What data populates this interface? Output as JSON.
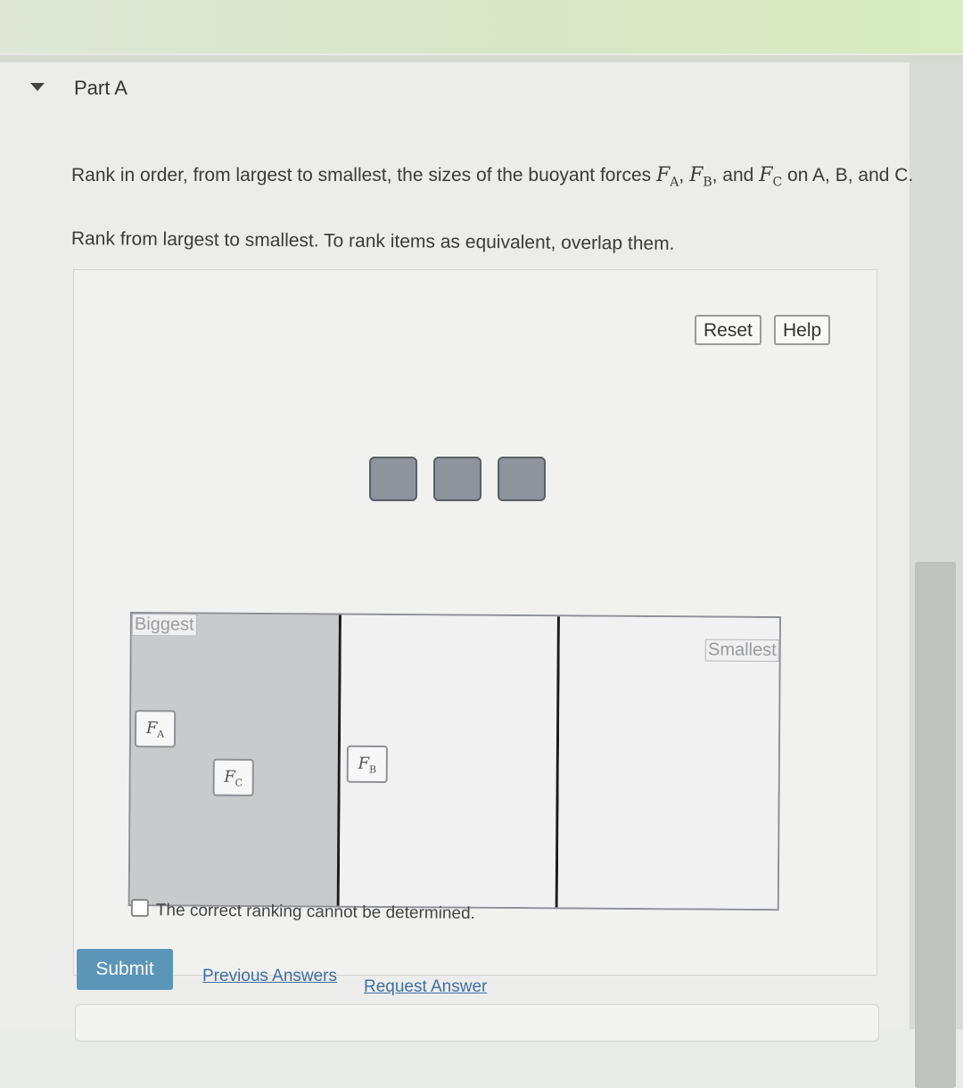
{
  "part": {
    "title": "Part A"
  },
  "question": {
    "text_before": "Rank in order, from largest to smallest, the sizes of the buoyant forces",
    "fa_letter": "F",
    "fa_sub": "A",
    "sep1": ",",
    "fb_letter": "F",
    "fb_sub": "B",
    "sep2": ", and",
    "fc_letter": "F",
    "fc_sub": "C",
    "text_after": "on A, B, and C."
  },
  "instruction": "Rank from largest to smallest. To rank items as equivalent, overlap them.",
  "toolbar": {
    "reset_label": "Reset",
    "help_label": "Help"
  },
  "ranking": {
    "biggest_label": "Biggest",
    "smallest_label": "Smallest",
    "items": [
      {
        "letter": "F",
        "sub": "A"
      },
      {
        "letter": "F",
        "sub": "C"
      },
      {
        "letter": "F",
        "sub": "B"
      }
    ]
  },
  "cannot_determine_label": "The correct ranking cannot be determined.",
  "actions": {
    "submit_label": "Submit",
    "previous_answers_label": "Previous Answers",
    "request_answer_label": "Request Answer"
  }
}
